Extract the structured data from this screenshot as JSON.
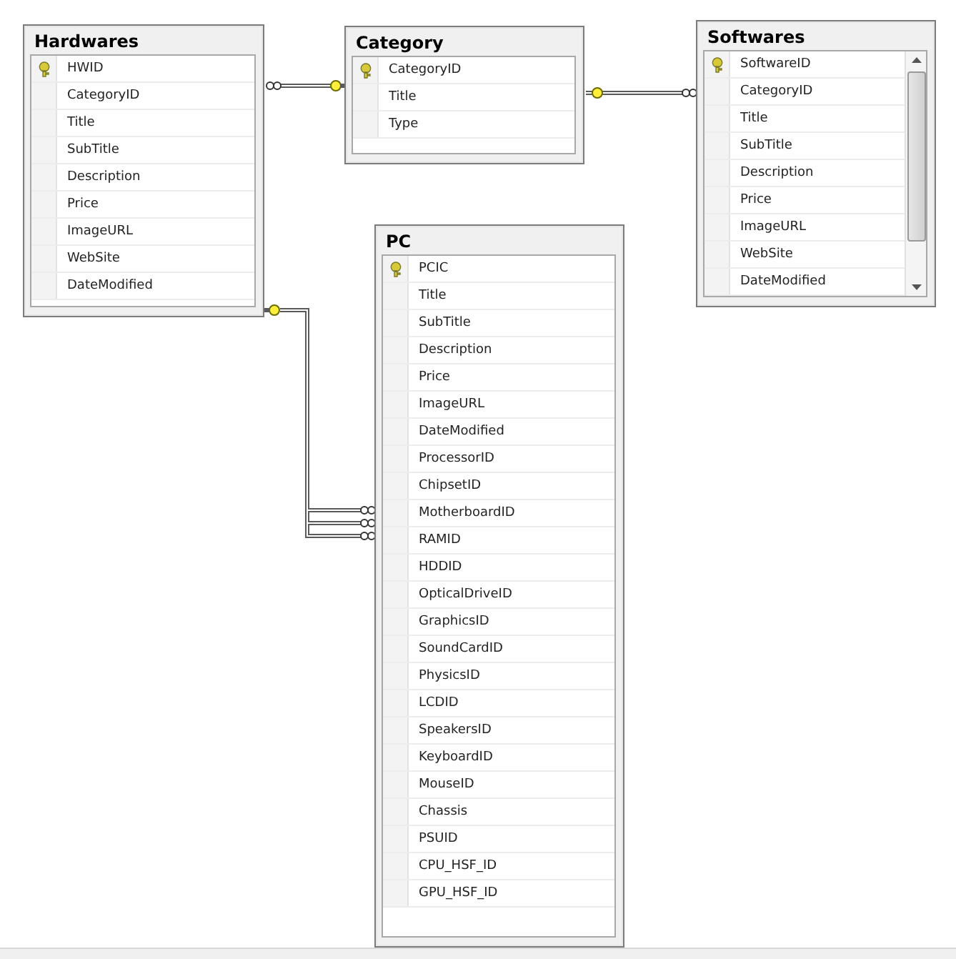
{
  "tables": [
    {
      "title": "Hardwares",
      "scrollable": false,
      "columns": [
        {
          "name": "HWID",
          "key": true
        },
        {
          "name": "CategoryID",
          "key": false
        },
        {
          "name": "Title",
          "key": false
        },
        {
          "name": "SubTitle",
          "key": false
        },
        {
          "name": "Description",
          "key": false
        },
        {
          "name": "Price",
          "key": false
        },
        {
          "name": "ImageURL",
          "key": false
        },
        {
          "name": "WebSite",
          "key": false
        },
        {
          "name": "DateModified",
          "key": false
        }
      ]
    },
    {
      "title": "Category",
      "scrollable": false,
      "columns": [
        {
          "name": "CategoryID",
          "key": true
        },
        {
          "name": "Title",
          "key": false
        },
        {
          "name": "Type",
          "key": false
        }
      ]
    },
    {
      "title": "Softwares",
      "scrollable": true,
      "columns": [
        {
          "name": "SoftwareID",
          "key": true
        },
        {
          "name": "CategoryID",
          "key": false
        },
        {
          "name": "Title",
          "key": false
        },
        {
          "name": "SubTitle",
          "key": false
        },
        {
          "name": "Description",
          "key": false
        },
        {
          "name": "Price",
          "key": false
        },
        {
          "name": "ImageURL",
          "key": false
        },
        {
          "name": "WebSite",
          "key": false
        },
        {
          "name": "DateModified",
          "key": false
        }
      ]
    },
    {
      "title": "PC",
      "scrollable": false,
      "columns": [
        {
          "name": "PCIC",
          "key": true
        },
        {
          "name": "Title",
          "key": false
        },
        {
          "name": "SubTitle",
          "key": false
        },
        {
          "name": "Description",
          "key": false
        },
        {
          "name": "Price",
          "key": false
        },
        {
          "name": "ImageURL",
          "key": false
        },
        {
          "name": "DateModified",
          "key": false
        },
        {
          "name": "ProcessorID",
          "key": false
        },
        {
          "name": "ChipsetID",
          "key": false
        },
        {
          "name": "MotherboardID",
          "key": false
        },
        {
          "name": "RAMID",
          "key": false
        },
        {
          "name": "HDDID",
          "key": false
        },
        {
          "name": "OpticalDriveID",
          "key": false
        },
        {
          "name": "GraphicsID",
          "key": false
        },
        {
          "name": "SoundCardID",
          "key": false
        },
        {
          "name": "PhysicsID",
          "key": false
        },
        {
          "name": "LCDID",
          "key": false
        },
        {
          "name": "SpeakersID",
          "key": false
        },
        {
          "name": "KeyboardID",
          "key": false
        },
        {
          "name": "MouseID",
          "key": false
        },
        {
          "name": "Chassis",
          "key": false
        },
        {
          "name": "PSUID",
          "key": false
        },
        {
          "name": "CPU_HSF_ID",
          "key": false
        },
        {
          "name": "GPU_HSF_ID",
          "key": false
        }
      ]
    }
  ]
}
